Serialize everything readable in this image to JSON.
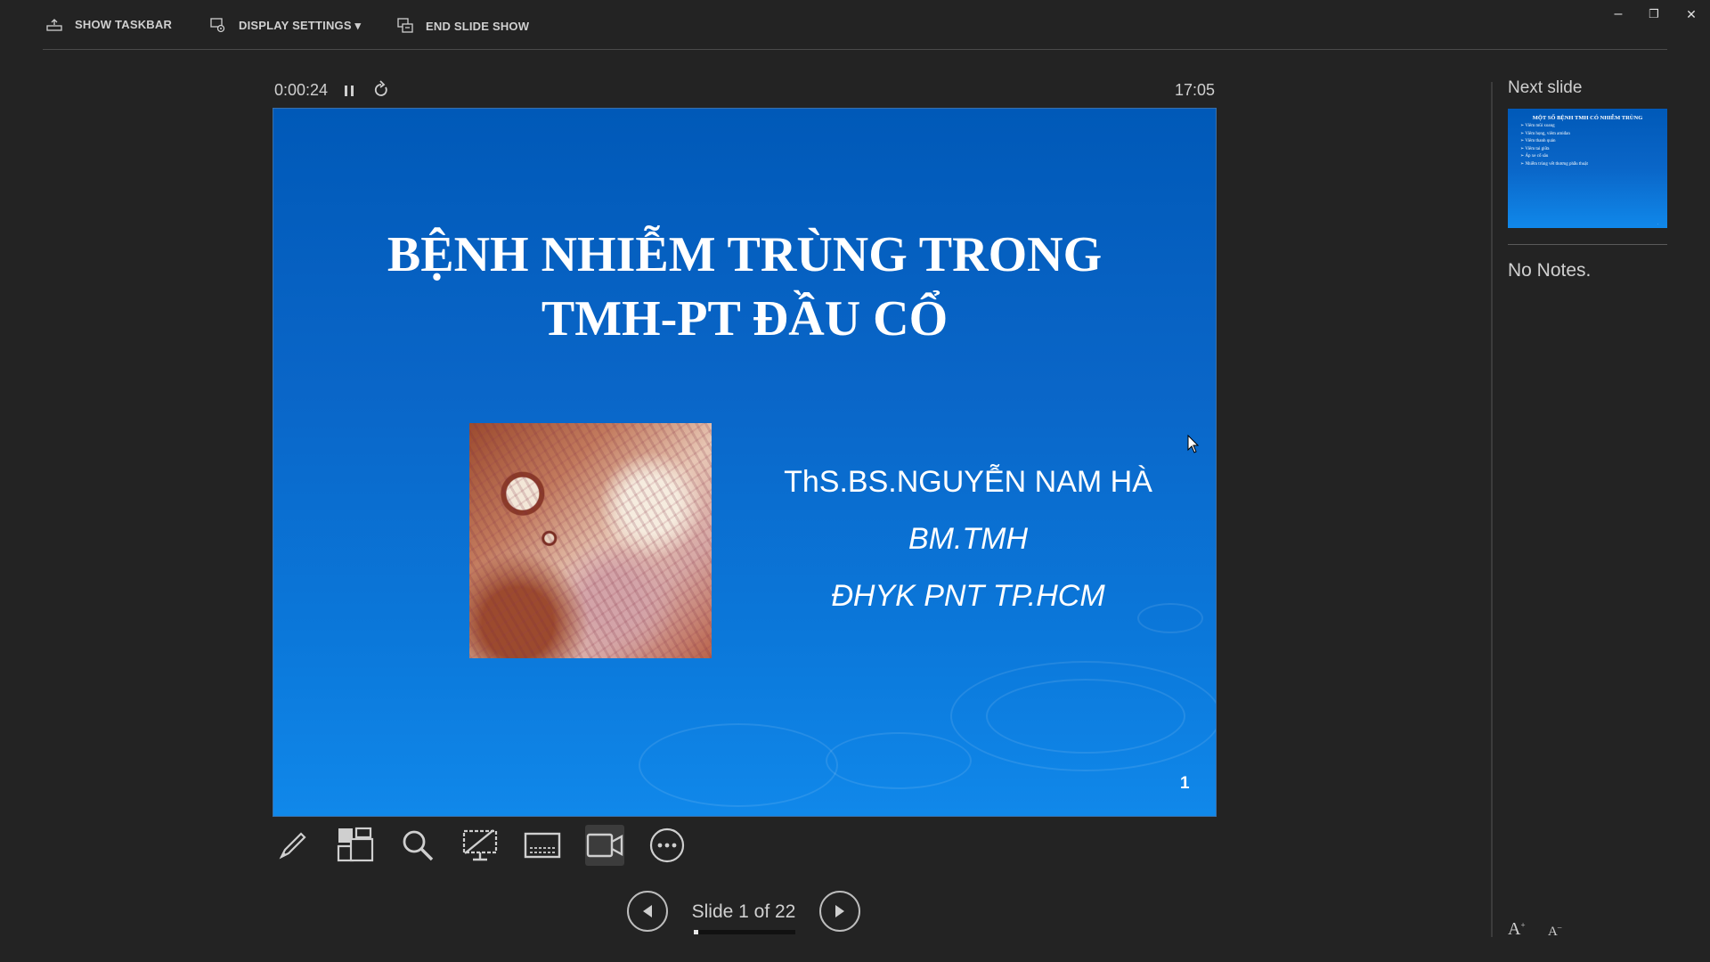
{
  "topbar": {
    "show_taskbar": "SHOW TASKBAR",
    "display_settings": "DISPLAY SETTINGS ▾",
    "end_slide_show": "END SLIDE SHOW"
  },
  "window_controls": {
    "minimize": "–",
    "restore": "❐",
    "close": "✕"
  },
  "presenter": {
    "elapsed_time": "0:00:24",
    "clock": "17:05"
  },
  "current_slide": {
    "title_line1": "BỆNH NHIỄM TRÙNG TRONG",
    "title_line2": "TMH-PT ĐẦU CỔ",
    "author": "ThS.BS.NGUYỄN NAM HÀ",
    "department": "BM.TMH",
    "school": "ĐHYK PNT TP.HCM",
    "slide_number": "1"
  },
  "tools": [
    "pen-tool",
    "see-all-slides",
    "zoom",
    "black-screen",
    "subtitles",
    "camera",
    "more-options"
  ],
  "navigation": {
    "counter": "Slide 1 of 22",
    "progress_fraction": 0.045
  },
  "side_panel": {
    "next_label": "Next slide",
    "next_slide_title": "MỘT SỐ BỆNH TMH CÓ NHIỄM TRÙNG",
    "next_slide_items": [
      "Viêm mũi xoang",
      "Viêm họng, viêm amiđan",
      "Viêm thanh quản",
      "Viêm tai giữa",
      "Áp xe cổ sâu",
      "Nhiễm trùng vết thương phẫu thuật"
    ],
    "notes": "No Notes.",
    "font_increase": "A",
    "font_decrease": "A"
  },
  "colors": {
    "background": "#232323",
    "slide_blue_top": "#0059b8",
    "slide_blue_bottom": "#1088ea",
    "text": "#d0d0d0"
  }
}
